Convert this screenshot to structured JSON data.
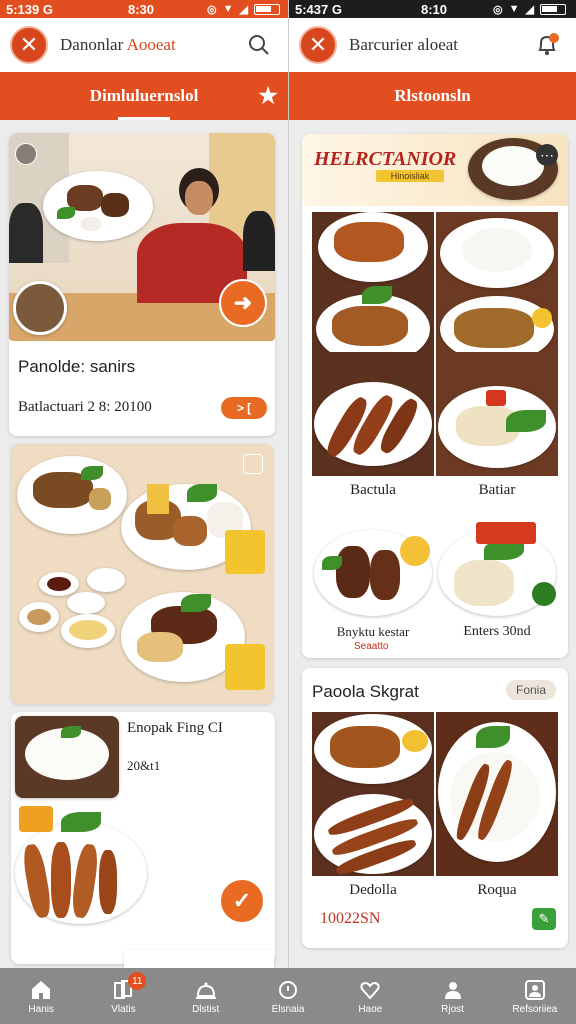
{
  "status_left": {
    "carrier": "5:139 G",
    "time": "8:30"
  },
  "status_right": {
    "carrier": "5:437 G",
    "time": "8:10"
  },
  "header_left": {
    "title_main": "Danonlar",
    "title_accent": "Aooeat"
  },
  "header_right": {
    "title": "Barcurier aloeat"
  },
  "tab_left": {
    "label": "Dimluluernslol"
  },
  "tab_right": {
    "label": "Rlstoonsln"
  },
  "card1": {
    "title": "Panolde: sanirs",
    "subtitle": "Batlactuari 2 8: 20100",
    "pill": "> ["
  },
  "card3": {
    "title": "Enopak Fing CI",
    "price": "20&t1"
  },
  "right_card1": {
    "banner": "HELRCTANIOR",
    "banner_tag": "Hinoisliak",
    "labels": [
      "Bactula",
      "Batiar",
      "Bnyktu kestar",
      "Enters 30nd"
    ],
    "sub_label": "Seaatto"
  },
  "right_card2": {
    "title": "Paoola Skgrat",
    "badge": "Fonia",
    "labels": [
      "Dedolla",
      "Roqua"
    ],
    "price": "10022SN"
  },
  "nav": {
    "items": [
      {
        "label": "Hanis",
        "icon": "home-icon"
      },
      {
        "label": "Vlatis",
        "icon": "cards-icon"
      },
      {
        "label": "Dlstist",
        "icon": "cloche-icon"
      },
      {
        "label": "Elsnaia",
        "icon": "search-icon"
      },
      {
        "label": "Haoe",
        "icon": "heart-icon"
      },
      {
        "label": "Rjost",
        "icon": "profile-icon"
      },
      {
        "label": "Refsoriiea",
        "icon": "user-icon"
      }
    ],
    "badge": "11"
  },
  "colors": {
    "accent": "#e24e1f",
    "nav_bg": "#8a8a8a",
    "dark_status": "#1d1d1d"
  }
}
